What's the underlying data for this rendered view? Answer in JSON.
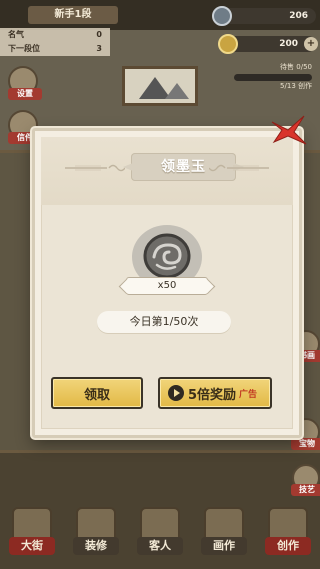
{
  "hud": {
    "rank_title": "新手1段",
    "stats": [
      {
        "label": "名气",
        "value": "0"
      },
      {
        "label": "下一段位",
        "value": "3"
      }
    ],
    "ink_amount": "206",
    "gold_amount": "200",
    "plus": "+",
    "ink_counter_label": "待售 0/50",
    "ink_counter_sub": "5/13 创作"
  },
  "side_left": [
    {
      "label": "设置"
    },
    {
      "label": "信件"
    }
  ],
  "side_right": [
    {
      "label": "书画"
    },
    {
      "label": "宝物"
    },
    {
      "label": "技艺"
    }
  ],
  "bottom_nav": [
    {
      "label": "大街"
    },
    {
      "label": "装修"
    },
    {
      "label": "客人"
    },
    {
      "label": "画作"
    },
    {
      "label": "创作"
    }
  ],
  "modal": {
    "title": "领墨玉",
    "item_count": "x50",
    "daily_progress": "今日第1/50次",
    "claim_label": "领取",
    "video_label": "5倍奖励",
    "ad_label": "广告"
  },
  "colors": {
    "accent_gold": "#e2b945",
    "close_red": "#d9342b",
    "ad_red": "#c23a22"
  }
}
